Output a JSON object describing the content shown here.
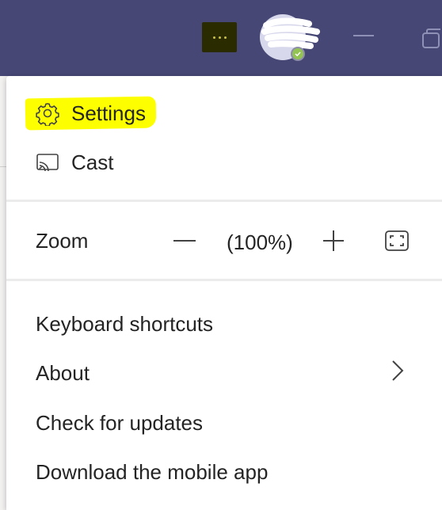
{
  "titlebar": {
    "more_icon": "more-horizontal-icon",
    "avatar_icon": "avatar",
    "presence_icon": "available-check-icon",
    "minimize_icon": "minimize-icon",
    "maximize_icon": "restore-icon",
    "color": "#464775"
  },
  "menu": {
    "settings_label": "Settings",
    "cast_label": "Cast",
    "zoom_label": "Zoom",
    "zoom_value": "(100%)",
    "keyboard_shortcuts_label": "Keyboard shortcuts",
    "about_label": "About",
    "check_updates_label": "Check for updates",
    "download_mobile_label": "Download the mobile app",
    "highlight_color": "#fdff00"
  }
}
